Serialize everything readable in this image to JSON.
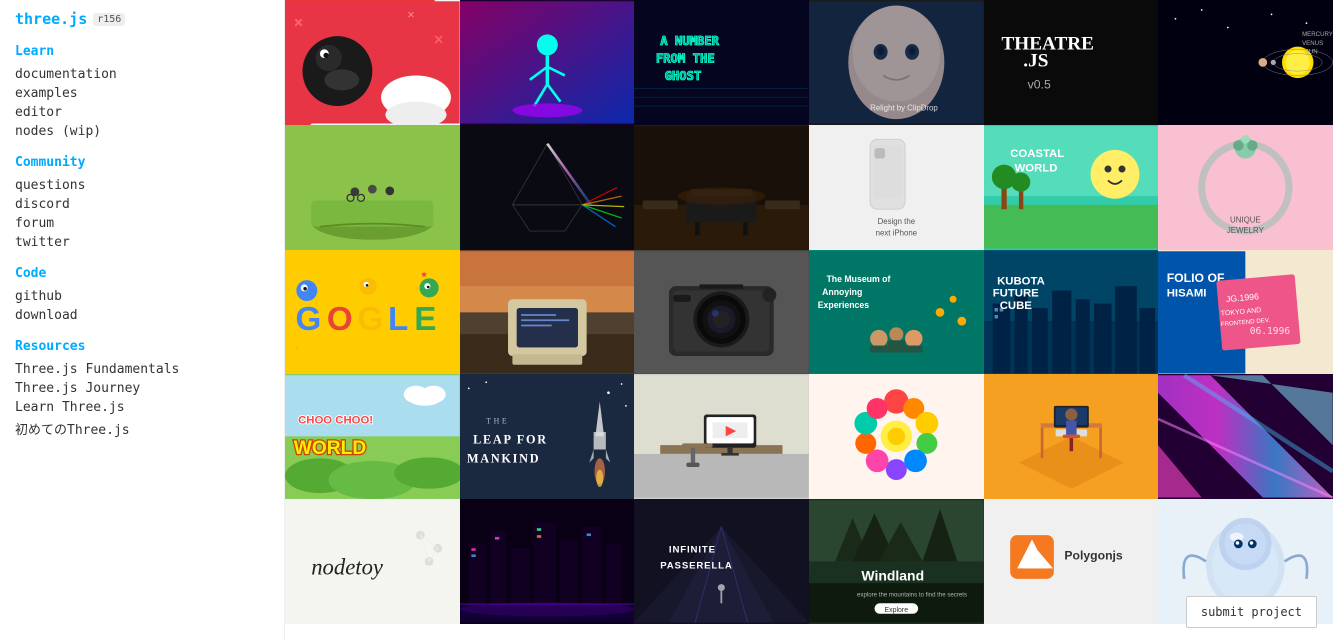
{
  "app": {
    "name": "three.js",
    "badge": "r156"
  },
  "sidebar": {
    "sections": [
      {
        "label": "Learn",
        "items": [
          "documentation",
          "examples",
          "editor",
          "nodes (wip)"
        ]
      },
      {
        "label": "Community",
        "items": [
          "questions",
          "discord",
          "forum",
          "twitter"
        ]
      },
      {
        "label": "Code",
        "items": [
          "github",
          "download"
        ]
      },
      {
        "label": "Resources",
        "items": [
          "Three.js Fundamentals",
          "Three.js Journey",
          "Learn Three.js",
          "初めてのThree.js"
        ]
      }
    ]
  },
  "submit_button": "submit project",
  "tiles": [
    {
      "bg": "#e8353a",
      "label": "",
      "style": "cartoon-hippo"
    },
    {
      "bg": "#c02090",
      "label": "",
      "style": "neon-figure"
    },
    {
      "bg": "#112244",
      "label": "A NUMBER FROM THE GHOST",
      "style": "neon-text"
    },
    {
      "bg": "#222",
      "label": "",
      "style": "face-relight"
    },
    {
      "bg": "#111",
      "label": "THEATRE.JS v0.5",
      "style": "theatre"
    },
    {
      "bg": "#000",
      "label": "MERCURY VENUS SUN",
      "style": "solar"
    },
    {
      "bg": "#8bc34a",
      "label": "",
      "style": "bikes-3d"
    },
    {
      "bg": "#222",
      "label": "",
      "style": "prism-light"
    },
    {
      "bg": "#3a2a1a",
      "label": "",
      "style": "piano"
    },
    {
      "bg": "#f5f5f5",
      "label": "Design the next iPhone",
      "style": "iphone"
    },
    {
      "bg": "#3db",
      "label": "COASTAL WORLD",
      "style": "coastal"
    },
    {
      "bg": "#f0a0c0",
      "label": "UNIQUE JEWELRY",
      "style": "jewelry"
    },
    {
      "bg": "#ffcc00",
      "label": "G O G L E",
      "style": "google-doodle"
    },
    {
      "bg": "#b05030",
      "label": "",
      "style": "old-computer"
    },
    {
      "bg": "#555",
      "label": "",
      "style": "camera"
    },
    {
      "bg": "#008888",
      "label": "The Museum of Annoying Experiences",
      "style": "museum"
    },
    {
      "bg": "#006699",
      "label": "KUBOTA FUTURE CUBE",
      "style": "kubota"
    },
    {
      "bg": "#f0e0d0",
      "label": "FOLIO HISAMI",
      "style": "folio"
    },
    {
      "bg": "#7dc87d",
      "label": "CHOO CHOO WORLD",
      "style": "choochoo"
    },
    {
      "bg": "#2a4060",
      "label": "THE LEAP FOR MANKIND",
      "style": "leap"
    },
    {
      "bg": "#ddd",
      "label": "",
      "style": "desk-scene"
    },
    {
      "bg": "#fff8f0",
      "label": "",
      "style": "flowers"
    },
    {
      "bg": "#f5a020",
      "label": "",
      "style": "developer-desk"
    },
    {
      "bg": "#cc44cc",
      "label": "",
      "style": "colorful-abstract"
    },
    {
      "bg": "#f5f5f0",
      "label": "nodetoy",
      "style": "nodetoy"
    },
    {
      "bg": "#110033",
      "label": "",
      "style": "neon-city"
    },
    {
      "bg": "#334422",
      "label": "INFINITE PASSERELLA",
      "style": "passerella"
    },
    {
      "bg": "#1a3a2a",
      "label": "Windland",
      "style": "windland"
    },
    {
      "bg": "#f47920",
      "label": "Polygonjs",
      "style": "polygonjs"
    },
    {
      "bg": "#fff",
      "label": "",
      "style": "glass-creature"
    }
  ]
}
